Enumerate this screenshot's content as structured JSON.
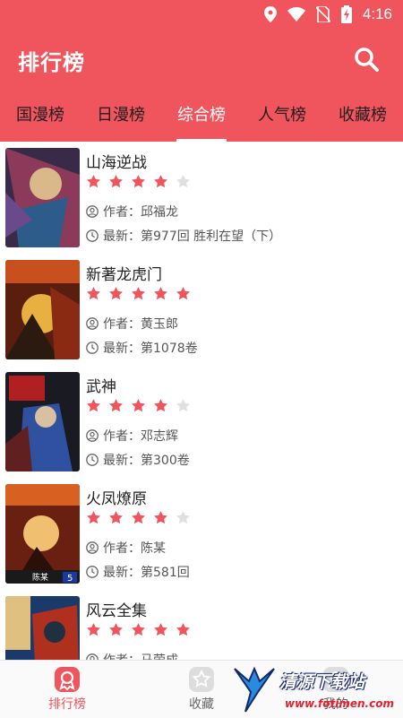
{
  "status_bar": {
    "time": "4:16",
    "icons": [
      "location-icon",
      "wifi-icon",
      "no-sim-icon",
      "battery-charging-icon"
    ]
  },
  "app_bar": {
    "title": "排行榜",
    "search_icon": "search-icon"
  },
  "tabs": [
    {
      "label": "国漫榜",
      "active": false
    },
    {
      "label": "日漫榜",
      "active": false
    },
    {
      "label": "综合榜",
      "active": true
    },
    {
      "label": "人气榜",
      "active": false
    },
    {
      "label": "收藏榜",
      "active": false
    }
  ],
  "list": [
    {
      "title": "山海逆战",
      "rating": 4,
      "author_label": "作者：",
      "author": "邱福龙",
      "latest_label": "最新：",
      "latest": "第977回 胜利在望（下）",
      "cover_colors": [
        "#3a2a4a",
        "#8b3a5a",
        "#d9b98a",
        "#2e5c8a"
      ]
    },
    {
      "title": "新著龙虎门",
      "rating": 5,
      "author_label": "作者：",
      "author": "黄玉郎",
      "latest_label": "最新：",
      "latest": "第1078卷",
      "cover_colors": [
        "#5a1e0e",
        "#c8501e",
        "#e8b040",
        "#2a1a10"
      ]
    },
    {
      "title": "武神",
      "rating": 4,
      "author_label": "作者：",
      "author": "邓志辉",
      "latest_label": "最新：",
      "latest": "第300卷",
      "cover_colors": [
        "#1a1a22",
        "#b02020",
        "#3050a0",
        "#d8c0a0"
      ]
    },
    {
      "title": "火凤燎原",
      "rating": 4,
      "author_label": "作者：",
      "author": "陈某",
      "latest_label": "最新：",
      "latest": "第581回",
      "cover_colors": [
        "#6a2010",
        "#d86020",
        "#f0c070",
        "#2a1008"
      ]
    },
    {
      "title": "风云全集",
      "rating": 5,
      "author_label": "作者：",
      "author": "马荣成",
      "latest_label": "最新：",
      "latest": "",
      "cover_colors": [
        "#1a3a6a",
        "#e0c080",
        "#b03020",
        "#203040"
      ]
    }
  ],
  "bottom_nav": [
    {
      "label": "排行榜",
      "icon": "ranking-icon",
      "active": true
    },
    {
      "label": "收藏",
      "icon": "collection-star-icon",
      "active": false
    },
    {
      "label": "我的",
      "icon": "profile-icon",
      "active": false
    }
  ],
  "watermark": {
    "text": "清源下载站",
    "url": "www.fotimen.com"
  },
  "colors": {
    "primary": "#f0545c",
    "star_on": "#f0545c",
    "star_off": "#e0e0e0"
  },
  "cover_labels": {
    "item_3_tag": "陈某",
    "item_3_badge": "5"
  }
}
